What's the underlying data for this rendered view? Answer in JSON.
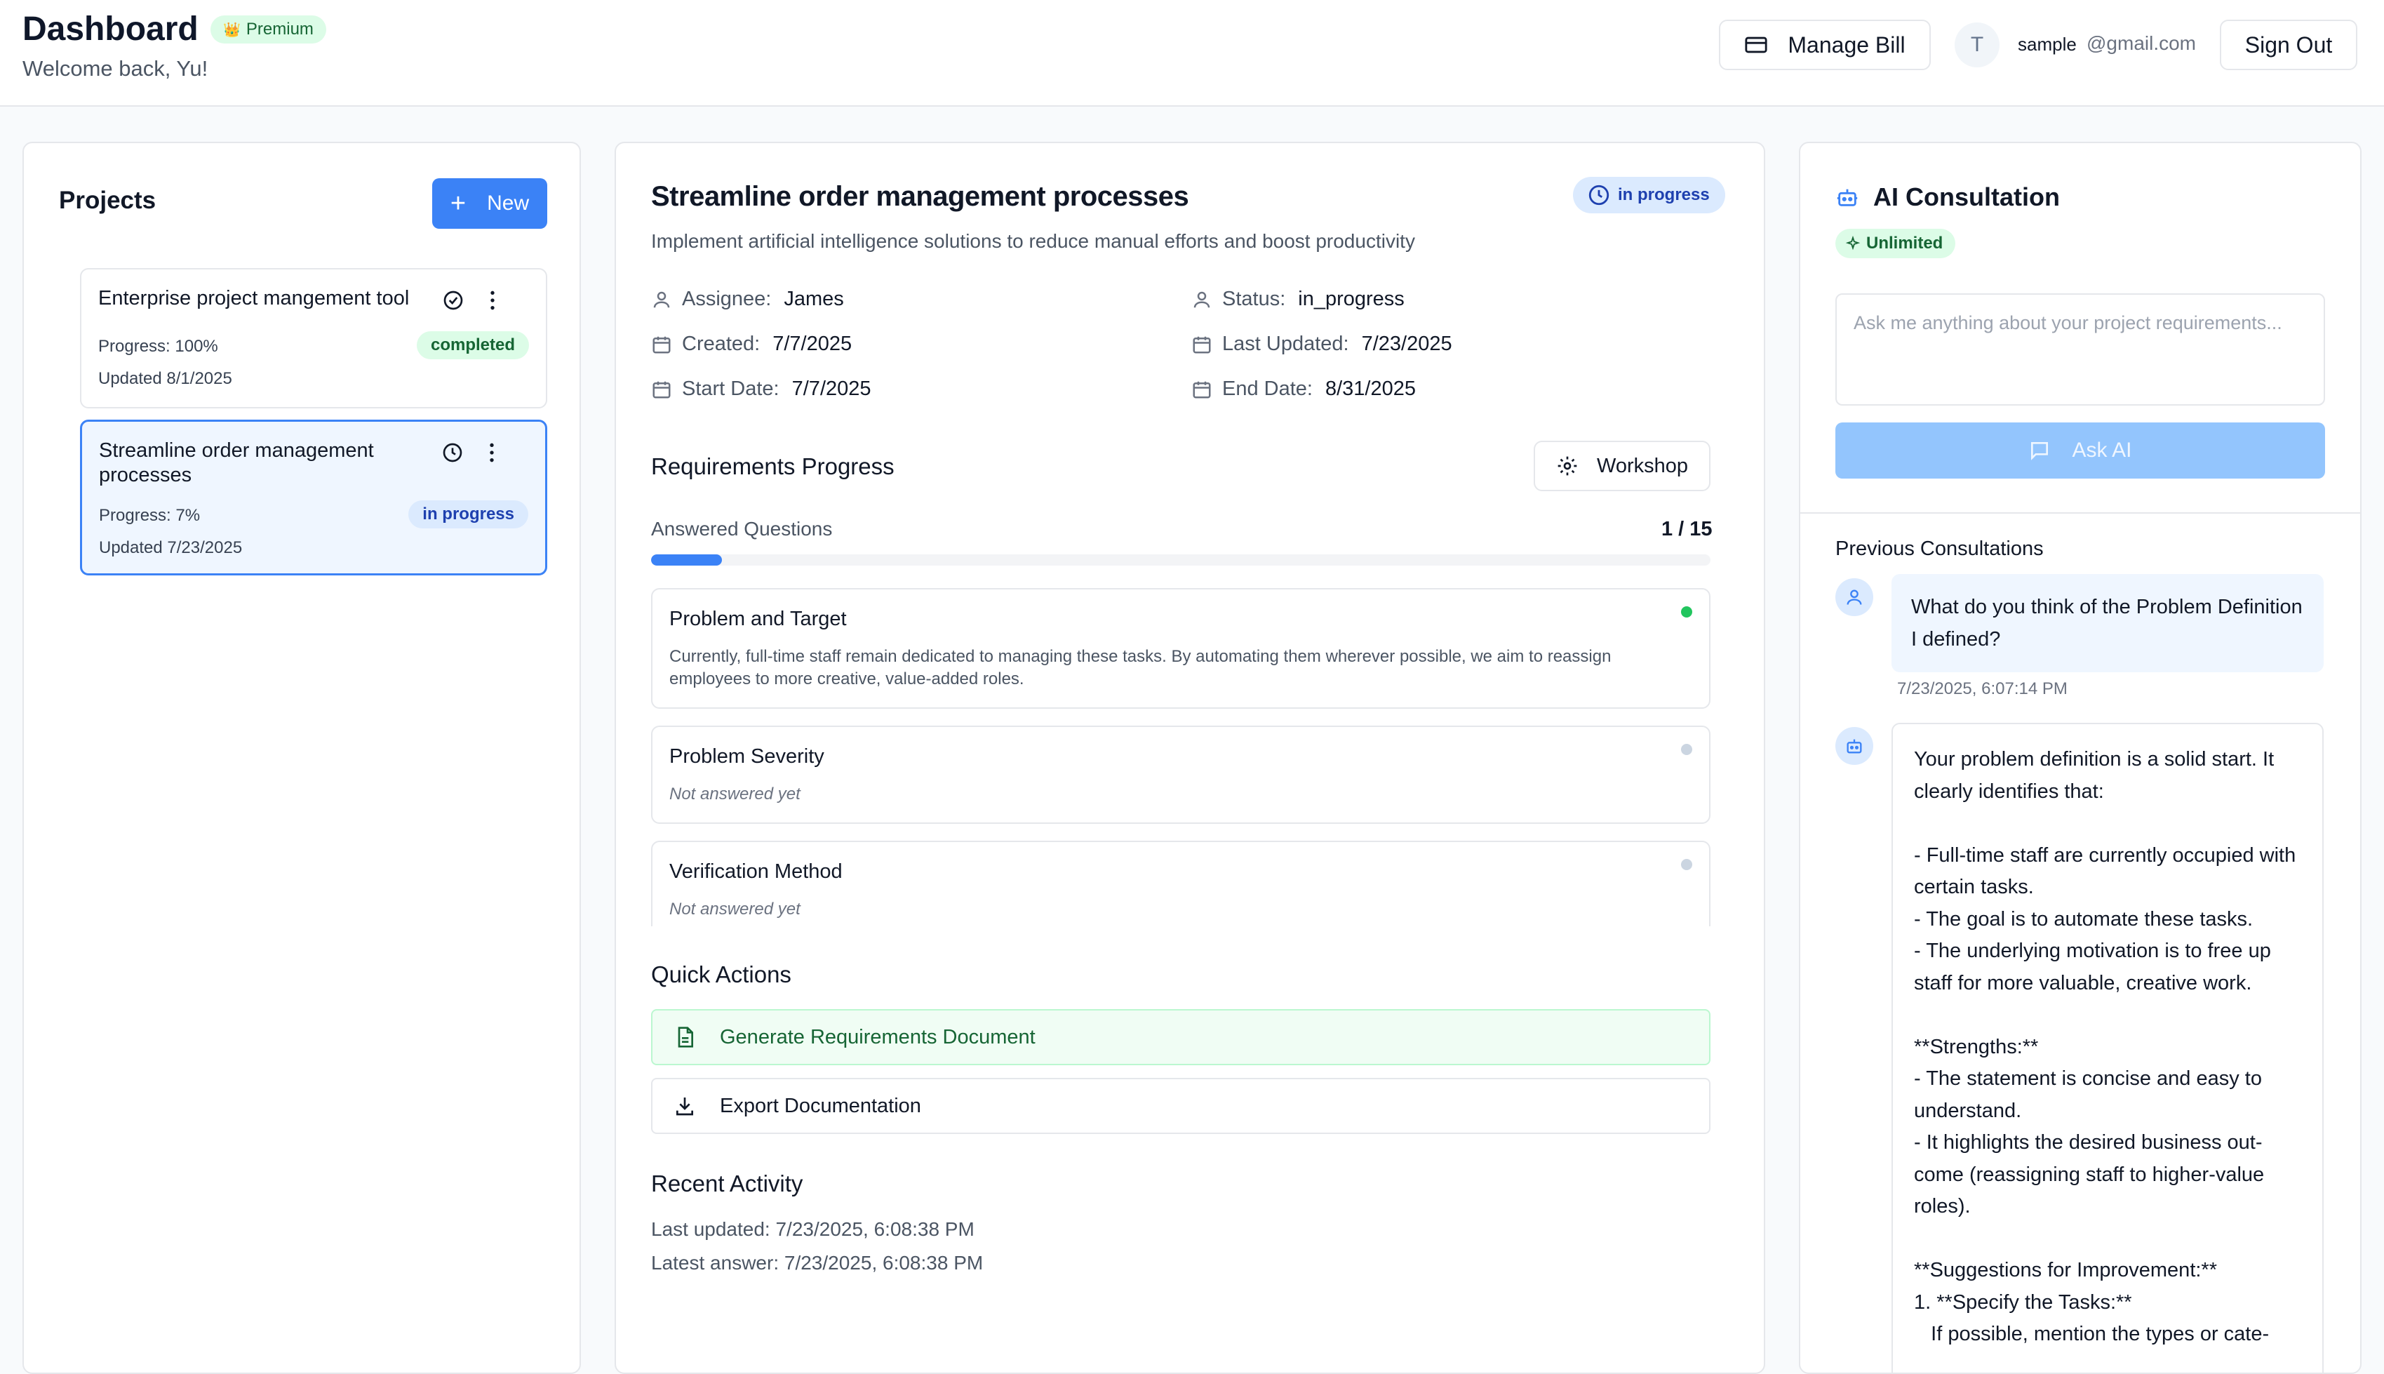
{
  "header": {
    "title": "Dashboard",
    "plan_badge": "Premium",
    "welcome": "Welcome back, Yu!",
    "manage_bill_label": "Manage Bill",
    "avatar_initial": "T",
    "email_name": "sample",
    "email_domain": "@gmail.com",
    "sign_out_label": "Sign Out"
  },
  "projects": {
    "heading": "Projects",
    "new_label": "New",
    "items": [
      {
        "name": "Enterprise project mangement tool",
        "progress": "Progress: 100%",
        "updated": "Updated 8/1/2025",
        "status": "completed",
        "status_icon": "check-circle-icon"
      },
      {
        "name": "Streamline order management processes",
        "progress": "Progress: 7%",
        "updated": "Updated 7/23/2025",
        "status": "in progress",
        "status_icon": "clock-icon"
      }
    ]
  },
  "detail": {
    "title": "Streamline order management processes",
    "status_pill": "in progress",
    "description": "Implement artificial intelligence solutions to reduce manual efforts and boost productivity",
    "meta": {
      "assignee_label": "Assignee:",
      "assignee": "James",
      "status_label": "Status:",
      "status": "in_progress",
      "created_label": "Created:",
      "created": "7/7/2025",
      "last_updated_label": "Last Updated:",
      "last_updated": "7/23/2025",
      "start_label": "Start Date:",
      "start": "7/7/2025",
      "end_label": "End Date:",
      "end": "8/31/2025"
    },
    "requirements": {
      "heading": "Requirements Progress",
      "workshop_label": "Workshop",
      "answered_label": "Answered Questions",
      "answered_count": "1 / 15",
      "progress_fraction": 0.0667,
      "questions": [
        {
          "title": "Problem and Target",
          "answer": "Currently, full-time staff remain dedicated to managing these tasks. By automating them wherever possible, we aim to reassign employees to more creative, value-added roles.",
          "answered": true
        },
        {
          "title": "Problem Severity",
          "answer": "Not answered yet",
          "answered": false
        },
        {
          "title": "Verification Method",
          "answer": "Not answered yet",
          "answered": false
        }
      ]
    },
    "quick_actions": {
      "heading": "Quick Actions",
      "generate_label": "Generate Requirements Document",
      "export_label": "Export Documentation"
    },
    "recent_activity": {
      "heading": "Recent Activity",
      "last_updated": "Last updated: 7/23/2025, 6:08:38 PM",
      "latest_answer": "Latest answer: 7/23/2025, 6:08:38 PM"
    }
  },
  "ai": {
    "heading": "AI Consultation",
    "badge": "Unlimited",
    "placeholder": "Ask me anything about your project requirements...",
    "ask_label": "Ask AI",
    "previous_heading": "Previous Consultations",
    "user_message": "What do you think of the Problem Definition I defined?",
    "user_time": "7/23/2025, 6:07:14 PM",
    "ai_message": "Your problem definition is a solid start. It clearly identifies that:\n\n- Full-time staff are currently occupied with certain tasks.\n- The goal is to automate these tasks.\n- The underlying motivation is to free up staff for more valuable, creative work.\n\n**Strengths:**\n- The statement is concise and easy to understand.\n- It highlights the desired business out-come (reassigning staff to higher-value roles).\n\n**Suggestions for Improvement:**\n1. **Specify the Tasks:**\n   If possible, mention the types or cate-"
  },
  "colors": {
    "accent": "#3b82f6",
    "success": "#22c55e",
    "pending": "#cbd5e1"
  }
}
